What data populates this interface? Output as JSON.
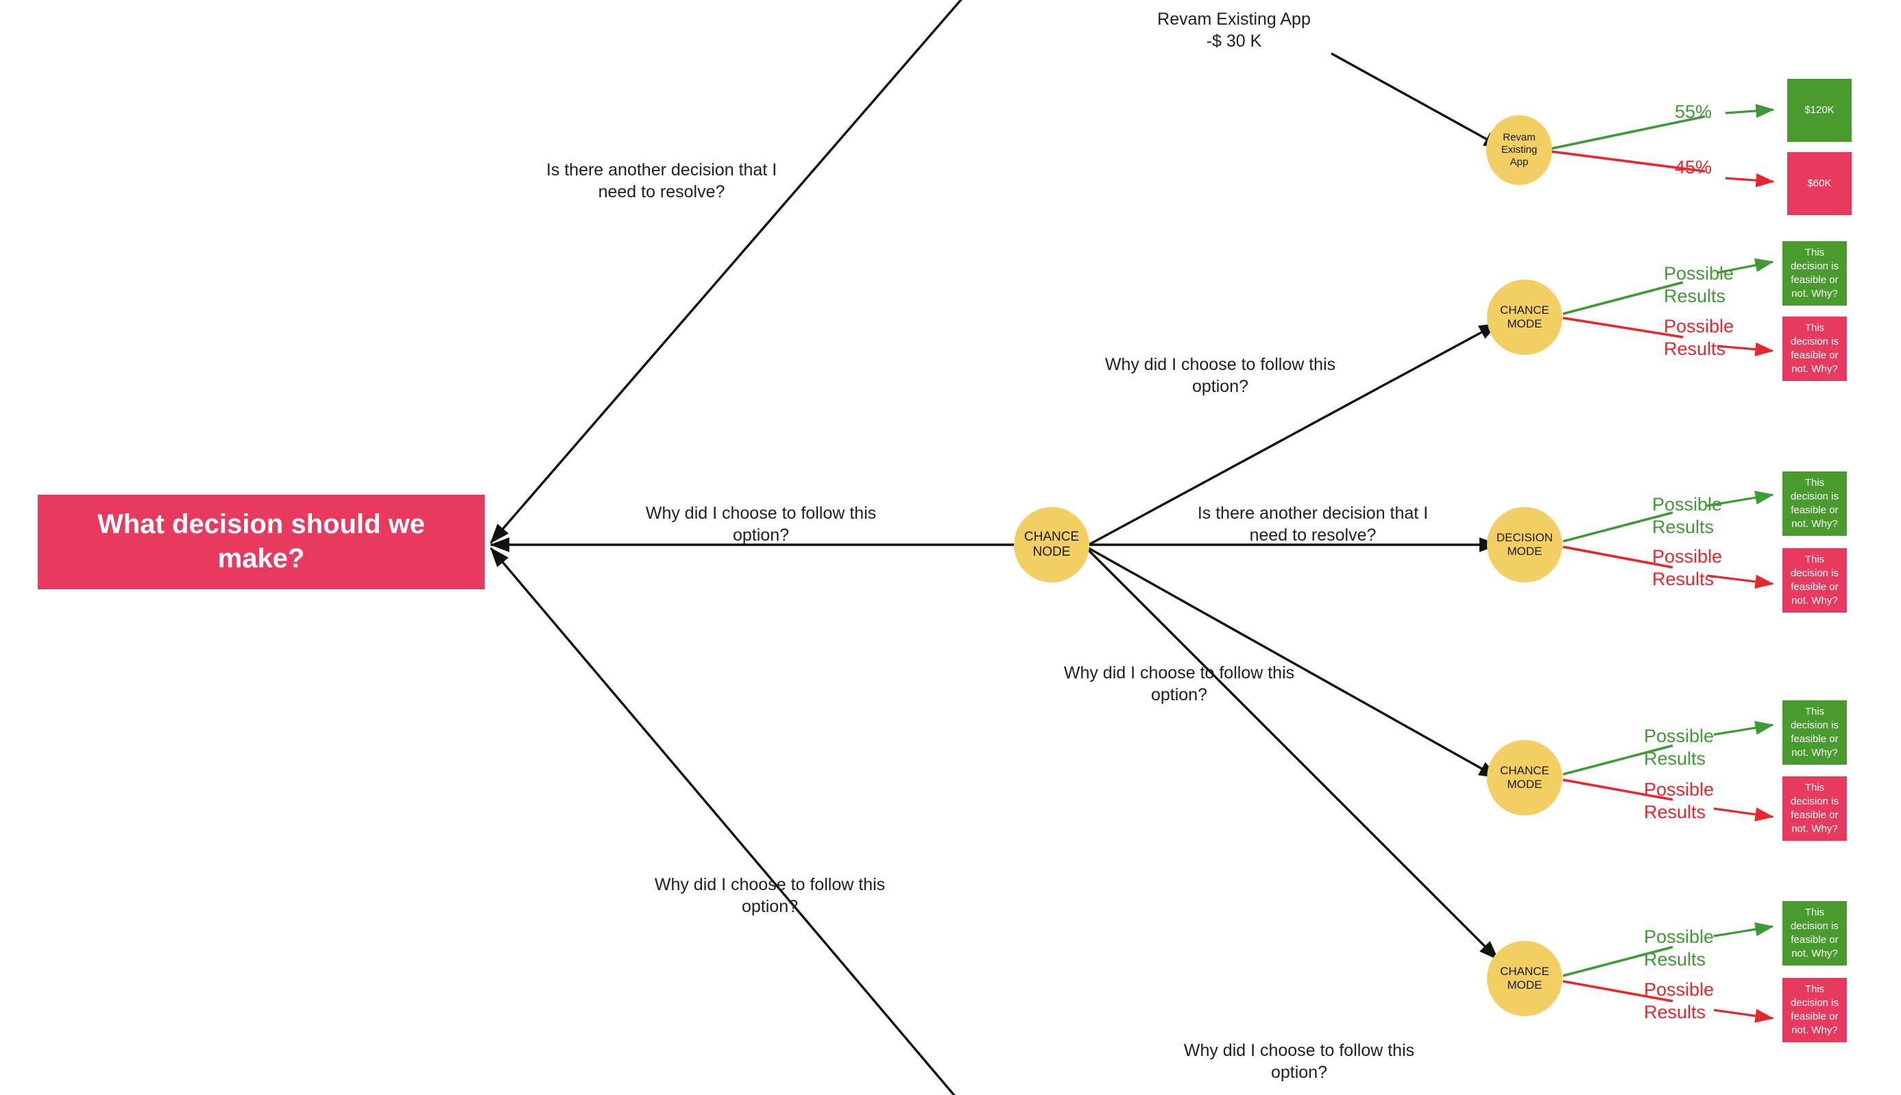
{
  "diagram": {
    "type": "decision-tree",
    "title_node": "What decision should we make?",
    "colors": {
      "root_fill": "#E83A5F",
      "node_fill": "#F3CE63",
      "positive_fill": "#4A9B2E",
      "negative_fill": "#E83A5F",
      "positive_text": "#3E9A33",
      "negative_text": "#E8262C",
      "edge_stroke": "#111111"
    }
  },
  "root": {
    "label": "What decision should we make?"
  },
  "edge_labels": {
    "to_branch_top": "Is there another decision that I\nneed to resolve?",
    "to_branch_middle": "Why did I choose to follow this\noption?",
    "to_branch_bottom": "Why did I choose to follow this\noption?",
    "revamp_cost": "Revam Existing App\n-$ 30 K",
    "chance_to_upper": "Why did I choose to follow this\noption?",
    "chance_to_decision": "Is there another decision that I\nneed to resolve?",
    "chance_to_lower": "Why did I choose to follow this\noption?",
    "chance_to_bottom": "Why did I choose to follow this\noption?"
  },
  "center_node": {
    "label": "CHANCE\nNODE"
  },
  "branches": [
    {
      "id": "revamp",
      "node_label": "Revam\nExisting\nApp",
      "positive_branch_label": "55%",
      "negative_branch_label": "45%",
      "positive_outcome": "$120K",
      "negative_outcome": "$60K"
    },
    {
      "id": "chance-upper",
      "node_label": "CHANCE\nMODE",
      "positive_branch_label": "Possible\nResults",
      "negative_branch_label": "Possible\nResults",
      "positive_outcome": "This\ndecision is\nfeasible or\nnot. Why?",
      "negative_outcome": "This\ndecision is\nfeasible or\nnot. Why?"
    },
    {
      "id": "decision-mode",
      "node_label": "DECISION\nMODE",
      "positive_branch_label": "Possible\nResults",
      "negative_branch_label": "Possible\nResults",
      "positive_outcome": "This\ndecision is\nfeasible or\nnot. Why?",
      "negative_outcome": "This\ndecision is\nfeasible or\nnot. Why?"
    },
    {
      "id": "chance-lower",
      "node_label": "CHANCE\nMODE",
      "positive_branch_label": "Possible\nResults",
      "negative_branch_label": "Possible\nResults",
      "positive_outcome": "This\ndecision is\nfeasible or\nnot. Why?",
      "negative_outcome": "This\ndecision is\nfeasible or\nnot. Why?"
    },
    {
      "id": "chance-bottom",
      "node_label": "CHANCE\nMODE",
      "positive_branch_label": "Possible\nResults",
      "negative_branch_label": "Possible\nResults",
      "positive_outcome": "This\ndecision is\nfeasible or\nnot. Why?",
      "negative_outcome": "This\ndecision is\nfeasible or\nnot. Why?"
    }
  ]
}
